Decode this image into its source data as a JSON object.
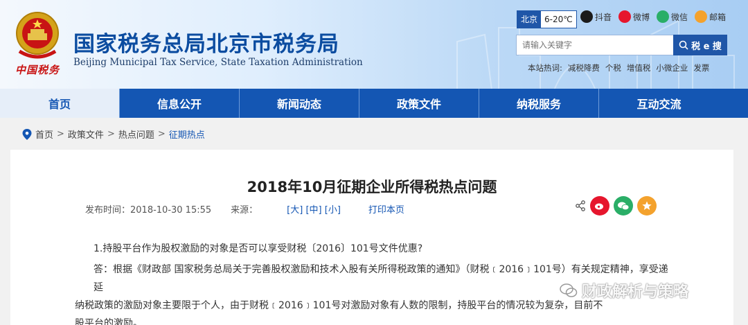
{
  "header": {
    "brand_script": "中国税务",
    "title_cn": "国家税务总局北京市税务局",
    "title_en": "Beijing Municipal Tax Service, State Taxation Administration",
    "weather": {
      "city": "北京",
      "temp": "6-20℃"
    },
    "socials": [
      {
        "label": "抖音",
        "color": "#1b1b1b"
      },
      {
        "label": "微博",
        "color": "#e6162d"
      },
      {
        "label": "微信",
        "color": "#2aae67"
      },
      {
        "label": "邮箱",
        "color": "#f4a22d"
      }
    ],
    "search": {
      "placeholder": "请输入关键字",
      "button": "税 e 搜"
    },
    "hot": {
      "label": "本站热词:",
      "words": [
        "减税降费",
        "个税",
        "增值税",
        "小微企业",
        "发票"
      ]
    }
  },
  "nav": [
    "首页",
    "信息公开",
    "新闻动态",
    "政策文件",
    "纳税服务",
    "互动交流"
  ],
  "breadcrumb": {
    "items": [
      "首页",
      "政策文件",
      "热点问题"
    ],
    "current": "征期热点"
  },
  "article": {
    "title": "2018年10月征期企业所得税热点问题",
    "date_label": "发布时间：2018-10-30 15:55",
    "source_label": "来源：",
    "sizes": [
      "[大]",
      "[中]",
      "[小]"
    ],
    "print": "打印本页",
    "question": "1.持股平台作为股权激励的对象是否可以享受财税〔2016〕101号文件优惠?",
    "answer_line1": "答：根据《财政部 国家税务总局关于完善股权激励和技术入股有关所得税政策的通知》（财税﹝2016﹞101号）有关规定精神，享受递延",
    "answer_line2": "纳税政策的激励对象主要限于个人，由于财税﹝2016﹞101号对激励对象有人数的限制，持股平台的情况较为复杂，目前不",
    "answer_line3": "股平台的激励。"
  },
  "watermark": "财政解析与策略"
}
